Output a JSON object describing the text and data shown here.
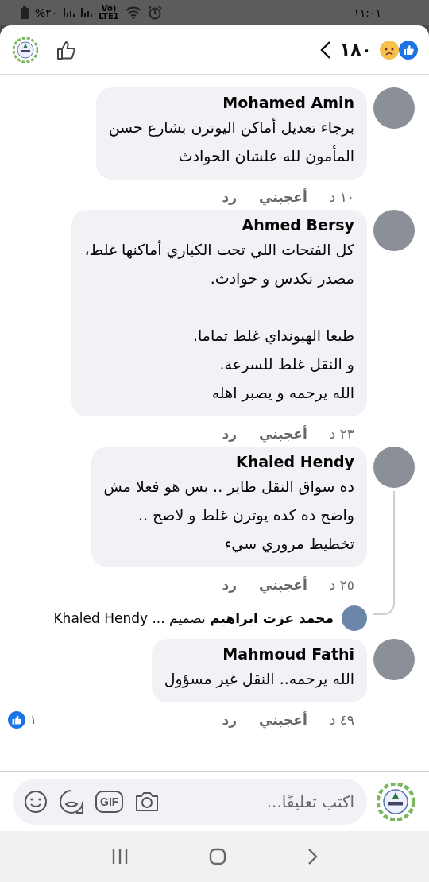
{
  "status_bar": {
    "time": "١١:٠١",
    "battery": "%٢٠",
    "network": "Vo)\nLTE1"
  },
  "header": {
    "reaction_count": "١٨٠"
  },
  "comments": [
    {
      "author": "Mohamed Amin",
      "text": "برجاء تعديل أماكن اليوترن بشارع حسن\nالمأمون لله علشان الحوادث",
      "time": "١٠ د",
      "like_label": "أعجبني",
      "reply_label": "رد"
    },
    {
      "author": "Ahmed Bersy",
      "text": "كل الفتحات اللي تحت الكباري أماكنها غلط،\nمصدر تكدس و حوادث.\n\nطبعا الهيونداي غلط تماما.\nو النقل غلط للسرعة.\nالله يرحمه و يصبر اهله",
      "time": "٢٣ د",
      "like_label": "أعجبني",
      "reply_label": "رد"
    },
    {
      "author": "Khaled Hendy",
      "text": "ده سواق النقل طاير .. بس هو فعلا مش\nواضح ده كده يوترن غلط و لاصح ..\nتخطيط مروري سيء",
      "time": "٢٥ د",
      "like_label": "أعجبني",
      "reply_label": "رد",
      "reply_preview": "**محمد عزت ابراهيم** تصميم ... Khaled Hendy"
    },
    {
      "author": "Mahmoud Fathi",
      "text": "الله يرحمه.. النقل غير مسؤول",
      "time": "٤٩ د",
      "like_label": "أعجبني",
      "reply_label": "رد",
      "reaction_count": "١"
    }
  ],
  "composer": {
    "placeholder": "اكتب تعليقًا...",
    "gif_label": "GIF"
  }
}
